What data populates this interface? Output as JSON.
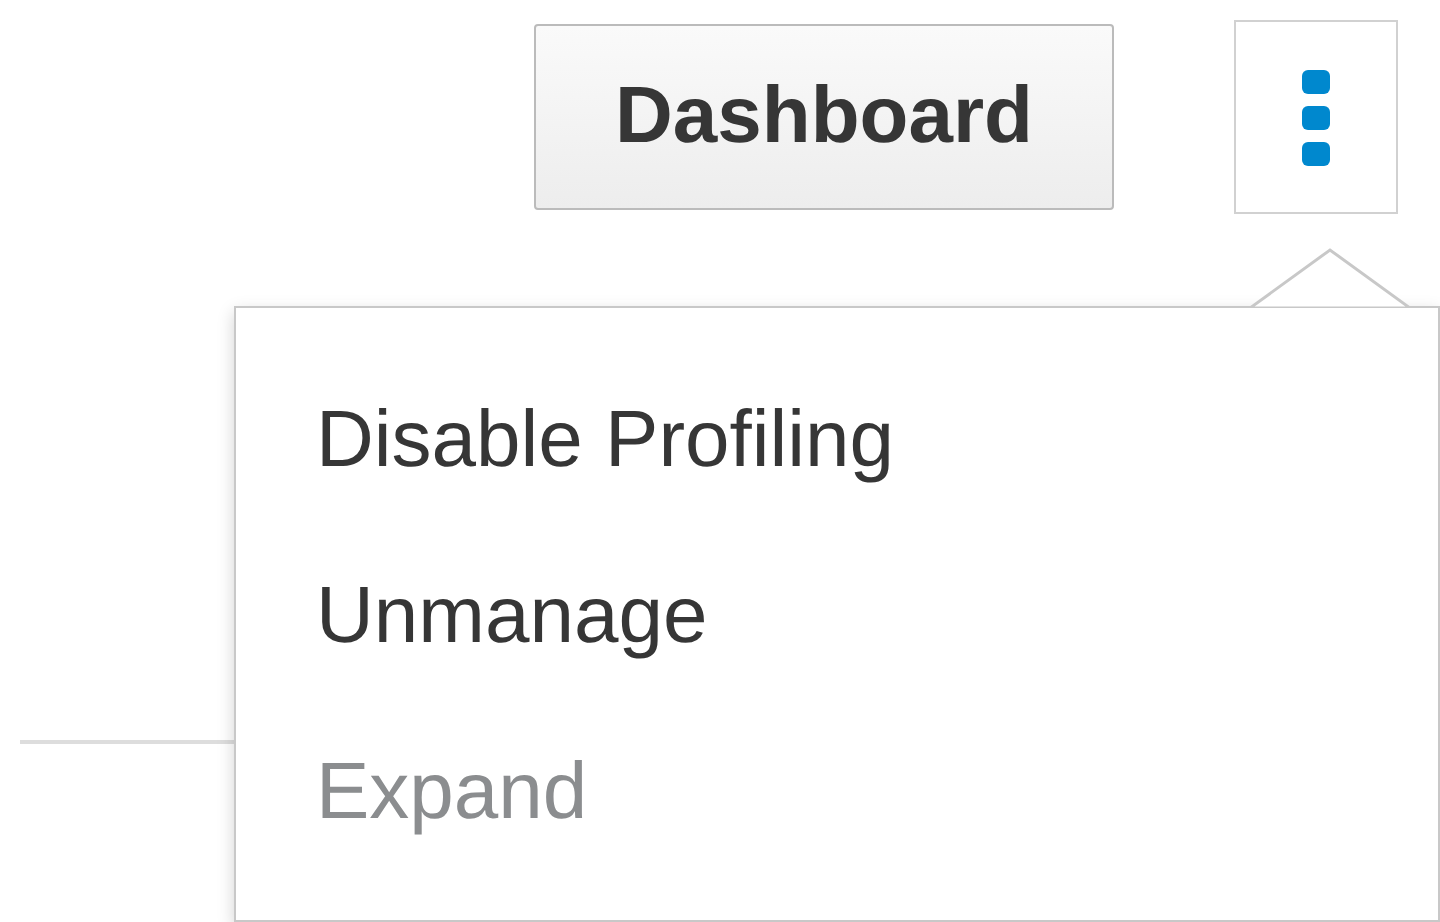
{
  "toolbar": {
    "dashboard_button": "Dashboard"
  },
  "menu": {
    "items": [
      {
        "label": "Disable Profiling",
        "disabled": false
      },
      {
        "label": "Unmanage",
        "disabled": false
      },
      {
        "label": "Expand",
        "disabled": true
      }
    ]
  }
}
